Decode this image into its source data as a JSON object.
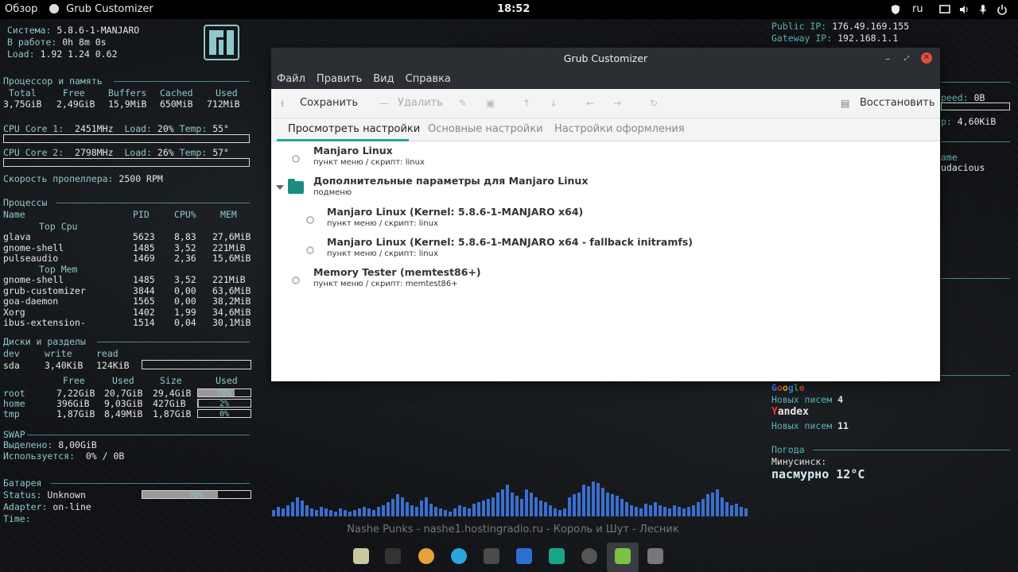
{
  "topbar": {
    "overview": "Обзор",
    "app_name": "Grub Customizer",
    "clock": "18:52",
    "lang": "ru"
  },
  "conky_left": {
    "system_label": "Система:",
    "system_value": "5.8.6-1-MANJARO",
    "uptime_label": "В работе:",
    "uptime_value": "0h 8m 0s",
    "load_label": "Load:",
    "load_value": "1.92 1.24 0.62",
    "mem_section": "Процессор и память",
    "mem_headers": [
      "Total",
      "Free",
      "Buffers",
      "Cached",
      "Used"
    ],
    "mem_values": [
      "3,75GiB",
      "2,49GiB",
      "15,9MiB",
      "650MiB",
      "712MiB"
    ],
    "cpu1_label": "CPU Core 1:",
    "cpu1_freq": "2451MHz",
    "cpu1_load_label": "Load:",
    "cpu1_load": "20%",
    "cpu1_temp_label": "Temp:",
    "cpu1_temp": "55°",
    "cpu2_label": "CPU Core 2:",
    "cpu2_freq": "2798MHz",
    "cpu2_load_label": "Load:",
    "cpu2_load": "26%",
    "cpu2_temp_label": "Temp:",
    "cpu2_temp": "57°",
    "fan_label": "Скорость пропеллера:",
    "fan_value": "2500 RPM",
    "proc_section": "Процессы",
    "proc_headers": [
      "Name",
      "PID",
      "CPU%",
      "MEM"
    ],
    "top_cpu": "Top Cpu",
    "top_cpu_rows": [
      [
        "glava",
        "5623",
        "8,83",
        "27,6MiB"
      ],
      [
        "gnome-shell",
        "1485",
        "3,52",
        "221MiB"
      ],
      [
        "pulseaudio",
        "1469",
        "2,36",
        "15,6MiB"
      ]
    ],
    "top_mem": "Top Mem",
    "top_mem_rows": [
      [
        "gnome-shell",
        "1485",
        "3,52",
        "221MiB"
      ],
      [
        "grub-customizer",
        "3844",
        "0,00",
        "63,6MiB"
      ],
      [
        "goa-daemon",
        "1565",
        "0,00",
        "38,2MiB"
      ],
      [
        "Xorg",
        "1402",
        "1,99",
        "34,6MiB"
      ],
      [
        "ibus-extension-",
        "1514",
        "0,04",
        "30,1MiB"
      ]
    ],
    "disk_section": "Диски и разделы",
    "disk_headers": [
      "dev",
      "write",
      "read"
    ],
    "disk_dev": "sda",
    "disk_write": "3,40KiB",
    "disk_read": "124KiB",
    "fs_headers": [
      "Free",
      "Used",
      "Size",
      "Used"
    ],
    "fs_rows": [
      {
        "name": "root",
        "free": "7,22GiB",
        "used": "20,7GiB",
        "size": "29,4GiB",
        "pct": "70%",
        "frac": 0.7
      },
      {
        "name": "home",
        "free": "396GiB",
        "used": "9,03GiB",
        "size": "427GiB",
        "pct": "2%",
        "frac": 0.02
      },
      {
        "name": "tmp",
        "free": "1,87GiB",
        "used": "8,49MiB",
        "size": "1,87GiB",
        "pct": "0%",
        "frac": 0.0
      }
    ],
    "swap_section": "SWAP",
    "swap_alloc_label": "Выделено:",
    "swap_alloc": "8,00GiB",
    "swap_used_label": "Используется:",
    "swap_used": "0% / 0B",
    "battery_section": "Батарея",
    "battery_status_label": "Status:",
    "battery_status": "Unknown",
    "battery_pct": "70%",
    "battery_frac": 0.7,
    "adapter_label": "Adapter:",
    "adapter_value": "on-line",
    "time_label": "Time:"
  },
  "conky_right": {
    "public_ip_label": "Public IP:",
    "public_ip": "176.49.169.155",
    "gateway_label": "Gateway IP:",
    "gateway_ip": "192.168.1.1",
    "speed_label": "peed:",
    "speed_value": "0B",
    "up_label": "p:",
    "up_value": "4,60KiB",
    "ame": "ame",
    "udacious": "udacious",
    "google_label": "Google",
    "google_mail_label": "Новых писем",
    "google_mail": "4",
    "yandex_label": "Yandex",
    "yandex_mail_label": "Новых писем",
    "yandex_mail": "11",
    "weather_section": "Погода",
    "city": "Минусинск:",
    "weather": "пасмурно 12°C"
  },
  "window": {
    "title": "Grub Customizer",
    "menu": [
      "Файл",
      "Править",
      "Вид",
      "Справка"
    ],
    "save": "Сохранить",
    "delete": "Удалить",
    "restore": "Восстановить",
    "tabs": [
      "Просмотреть настройки",
      "Основные настройки",
      "Настройки оформления"
    ],
    "entries": [
      {
        "title": "Manjaro Linux",
        "sub": "пункт меню / скрипт: linux"
      },
      {
        "title": "Дополнительные параметры для Manjaro Linux",
        "sub": "подменю"
      },
      {
        "title": "Manjaro Linux (Kernel: 5.8.6-1-MANJARO x64)",
        "sub": "пункт меню / скрипт: linux"
      },
      {
        "title": "Manjaro Linux (Kernel: 5.8.6-1-MANJARO x64 - fallback initramfs)",
        "sub": "пункт меню / скрипт: linux"
      },
      {
        "title": "Memory Tester (memtest86+)",
        "sub": "пункт меню / скрипт: memtest86+"
      }
    ]
  },
  "now_playing": "Nashe Punks - nashe1.hostingradio.ru - Король и Шут - Лесник",
  "dock_icons": [
    "files-icon",
    "terminal-icon",
    "chrome-icon",
    "telegram-icon",
    "downloader-icon",
    "software-icon",
    "manjaro-settings-icon",
    "amazon-icon",
    "grub-customizer-icon",
    "app-grid-icon"
  ]
}
